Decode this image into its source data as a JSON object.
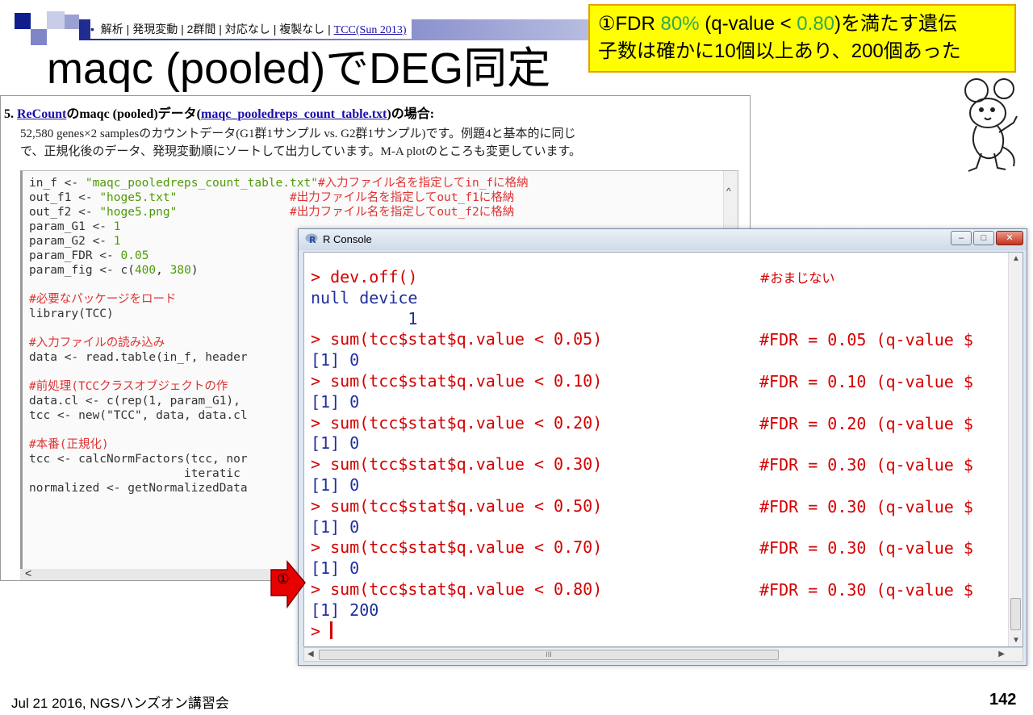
{
  "breadcrumb": {
    "bullet": "•",
    "text": "解析 | 発現変動 | 2群間 | 対応なし | 複製なし |",
    "link": "TCC(Sun 2013)"
  },
  "slide_title": "maqc (pooled)でDEG同定",
  "callout": {
    "circled": "①FDR ",
    "pct": "80%",
    "mid": " (q-value < ",
    "val": "0.80",
    "end": ")を満たす遺伝",
    "line2": "子数は確かに10個以上あり、200個あった"
  },
  "webpage": {
    "heading_num": "5. ",
    "heading_link1": "ReCount",
    "heading_mid": "のmaqc (pooled)データ(",
    "heading_link2": "maqc_pooledreps_count_table.txt",
    "heading_end": ")の場合:",
    "desc_line1": "52,580 genes×2 samplesのカウントデータ(G1群1サンプル vs. G2群1サンプル)です。例題4と基本的に同じ",
    "desc_line2": "で、正規化後のデータ、発現変動順にソートして出力しています。M-A plotのところも変更しています。",
    "code": {
      "l1a": "in_f <- ",
      "l1s": "\"maqc_pooledreps_count_table.txt\"",
      "l1c": "#入力ファイル名を指定してin_fに格納",
      "l2a": "out_f1 <- ",
      "l2s": "\"hoge5.txt\"",
      "l2pad": "                ",
      "l2c": "#出力ファイル名を指定してout_f1に格納",
      "l3a": "out_f2 <- ",
      "l3s": "\"hoge5.png\"",
      "l3pad": "                ",
      "l3c": "#出力ファイル名を指定してout_f2に格納",
      "l4a": "param_G1 <- ",
      "l4n": "1",
      "l5a": "param_G2 <- ",
      "l5n": "1",
      "l6a": "param_FDR <- ",
      "l6n": "0.05",
      "l7a": "param_fig <- c(",
      "l7n1": "400",
      "l7b": ", ",
      "l7n2": "380",
      "l7e": ")",
      "l9c": "#必要なパッケージをロード",
      "l10": "library(TCC)",
      "l12c": "#入力ファイルの読み込み",
      "l13": "data <- read.table(in_f, header",
      "l15c": "#前処理(TCCクラスオブジェクトの作",
      "l16": "data.cl <- c(rep(1, param_G1),",
      "l17": "tcc <- new(\"TCC\", data, data.cl",
      "l19c": "#本番(正規化)",
      "l20": "tcc <- calcNormFactors(tcc, nor",
      "l21": "                      iteratic",
      "l22": "normalized <- getNormalizedData"
    },
    "scroll_left": "<",
    "scroll_up": "^"
  },
  "rconsole": {
    "title": "R Console",
    "btn_min": "–",
    "btn_max": "□",
    "btn_close": "✕",
    "lines": {
      "c1": "> dev.off()",
      "o1": "null device",
      "o2": "          1",
      "c2": "> sum(tcc$stat$q.value < 0.05)",
      "o3": "[1] 0",
      "c3": "> sum(tcc$stat$q.value < 0.10)",
      "o4": "[1] 0",
      "c4": "> sum(tcc$stat$q.value < 0.20)",
      "o5": "[1] 0",
      "c5": "> sum(tcc$stat$q.value < 0.30)",
      "o6": "[1] 0",
      "c6": "> sum(tcc$stat$q.value < 0.50)",
      "o7": "[1] 0",
      "c7": "> sum(tcc$stat$q.value < 0.70)",
      "o8": "[1] 0",
      "c8": "> sum(tcc$stat$q.value < 0.80)",
      "o9": "[1] 200",
      "prompt": "> "
    },
    "comments": {
      "k1": "#おまじない",
      "k2": "#FDR = 0.05 (q-value $",
      "k3": "#FDR = 0.10 (q-value $",
      "k4": "#FDR = 0.20 (q-value $",
      "k5": "#FDR = 0.30 (q-value $",
      "k6": "#FDR = 0.30 (q-value $",
      "k7": "#FDR = 0.30 (q-value $",
      "k8": "#FDR = 0.30 (q-value $"
    },
    "hscroll_thumb": "III",
    "scroll_up": "▲",
    "scroll_down": "▼",
    "scroll_left": "◀",
    "scroll_right": "▶"
  },
  "marker_label": "①",
  "footer": {
    "left": "Jul 21 2016, NGSハンズオン講習会",
    "page": "142"
  }
}
